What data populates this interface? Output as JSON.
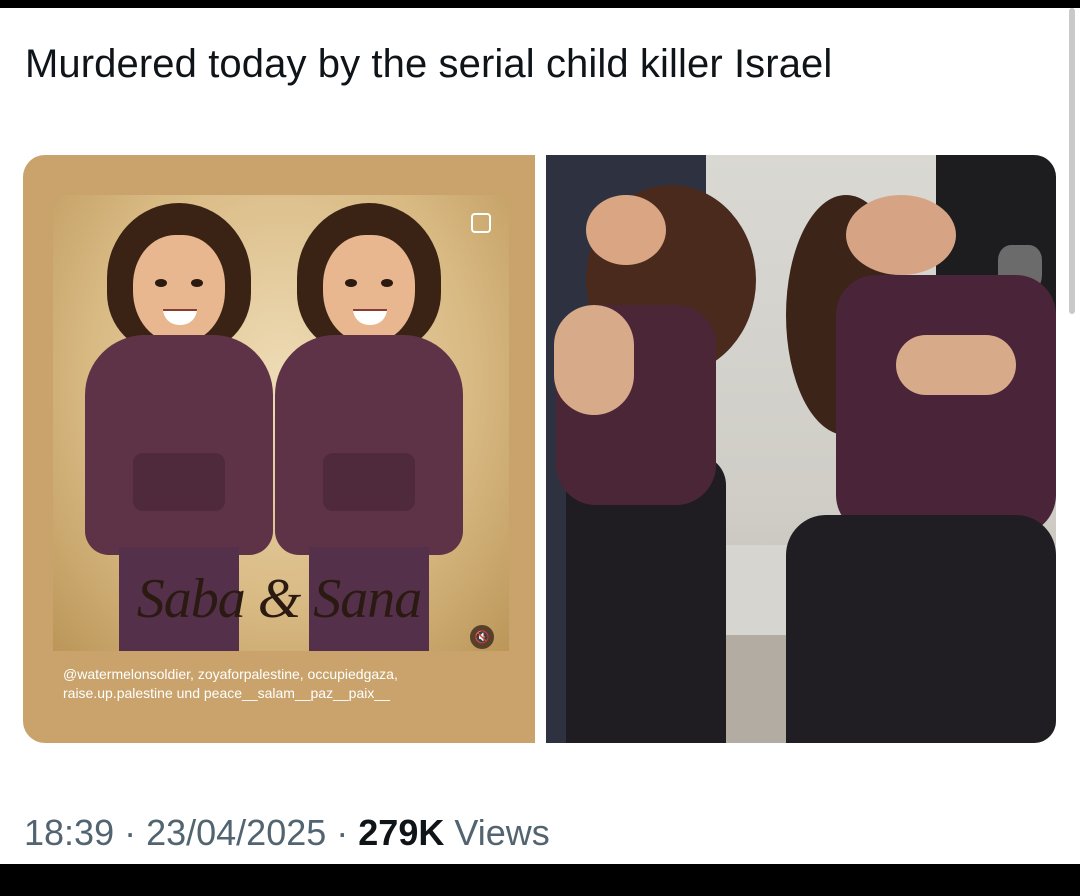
{
  "post": {
    "text": "Murdered today by the serial child killer Israel"
  },
  "media": {
    "left_image": {
      "names": "Saba & Sana",
      "credits_line1": "@watermelonsoldier, zoyaforpalestine, occupiedgaza,",
      "credits_line2": "raise.up.palestine und peace__salam__paz__paix__"
    }
  },
  "meta": {
    "time": "18:39",
    "separator1": " · ",
    "date": "23/04/2025",
    "separator2": " · ",
    "views_count": "279K",
    "views_label": " Views"
  },
  "colors": {
    "text_primary": "#0f1419",
    "text_secondary": "#536471",
    "left_image_frame": "#c9a36b"
  },
  "icons": [
    "instagram-multi-icon",
    "mute-icon"
  ]
}
